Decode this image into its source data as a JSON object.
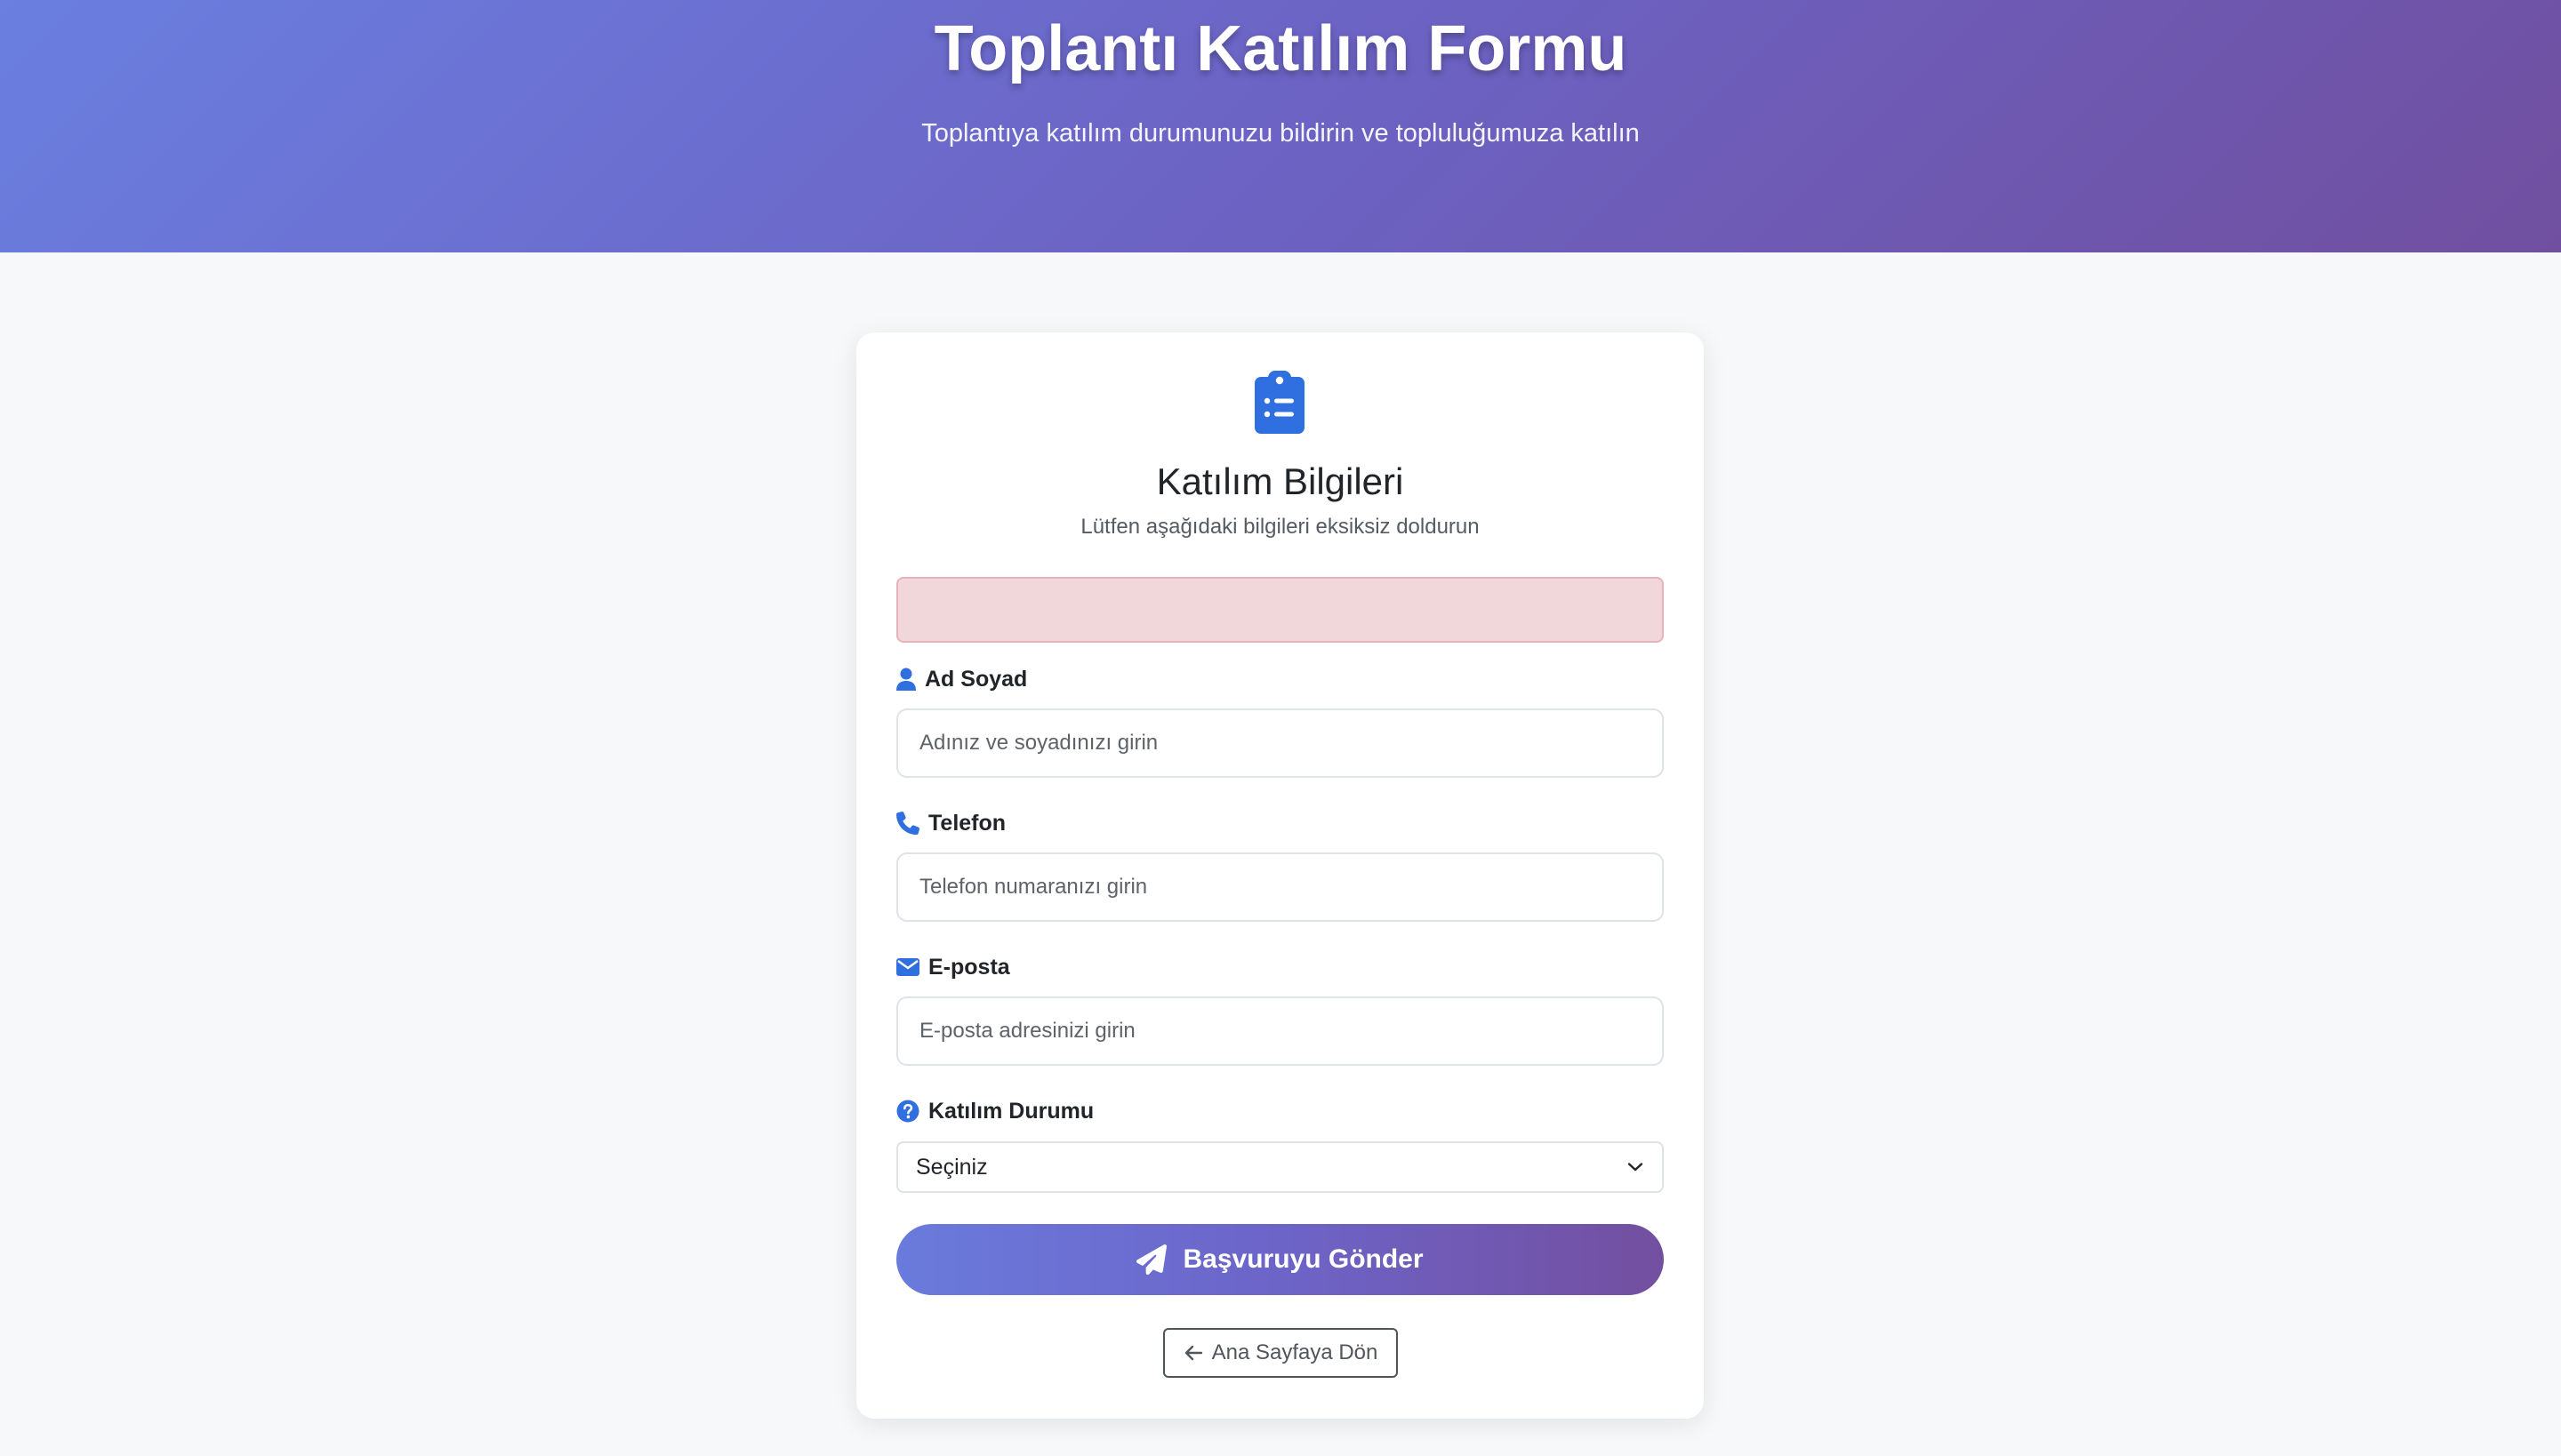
{
  "header": {
    "title": "Toplantı Katılım Formu",
    "subtitle": "Toplantıya katılım durumunuzu bildirin ve topluluğumuza katılın"
  },
  "card": {
    "icon": "clipboard-list-icon",
    "title": "Katılım Bilgileri",
    "subtitle": "Lütfen aşağıdaki bilgileri eksiksiz doldurun"
  },
  "alert": {
    "message": ""
  },
  "form": {
    "name": {
      "label": "Ad Soyad",
      "icon": "user-icon",
      "placeholder": "Adınız ve soyadınızı girin",
      "value": ""
    },
    "phone": {
      "label": "Telefon",
      "icon": "phone-icon",
      "placeholder": "Telefon numaranızı girin",
      "value": ""
    },
    "email": {
      "label": "E-posta",
      "icon": "envelope-icon",
      "placeholder": "E-posta adresinizi girin",
      "value": ""
    },
    "status": {
      "label": "Katılım Durumu",
      "icon": "question-circle-icon",
      "selected": "Seçiniz"
    },
    "submit_label": "Başvuruyu Gönder",
    "submit_icon": "paper-plane-icon",
    "back_label": "Ana Sayfaya Dön",
    "back_icon": "arrow-left-icon"
  },
  "colors": {
    "accent": "#2f6fe0",
    "gradient_start": "#6a7fe0",
    "gradient_end": "#704f9f",
    "alert_background": "#f2d7da",
    "alert_border": "#e8b3b8"
  }
}
